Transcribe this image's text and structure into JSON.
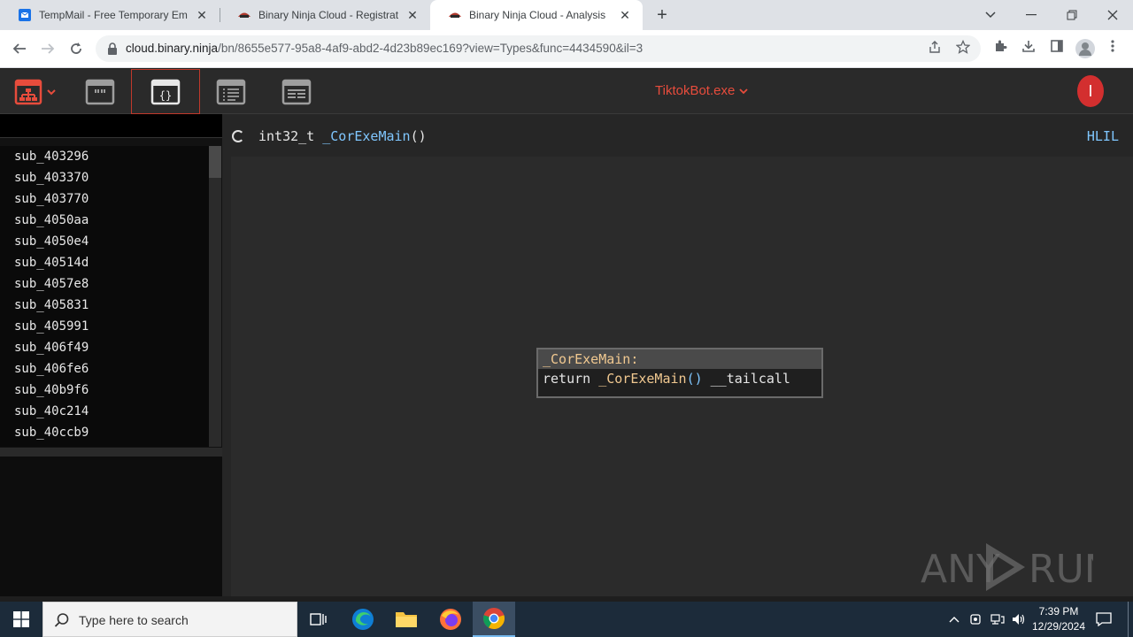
{
  "browser": {
    "tabs": [
      {
        "title": "TempMail - Free Temporary Ema",
        "active": false,
        "favicon": "tempmail-icon"
      },
      {
        "title": "Binary Ninja Cloud - Registration",
        "active": false,
        "favicon": "binja-icon"
      },
      {
        "title": "Binary Ninja Cloud - Analysis",
        "active": true,
        "favicon": "binja-icon"
      }
    ],
    "url_host": "cloud.binary.ninja",
    "url_path": "/bn/8655e577-95a8-4af9-abd2-4d23b89ec169?view=Types&func=4434590&il=3"
  },
  "app": {
    "file_title": "TiktokBot.exe",
    "user_initial": "I",
    "accent": "#e74c3c"
  },
  "sidebar": {
    "functions": [
      "sub_403296",
      "sub_403370",
      "sub_403770",
      "sub_4050aa",
      "sub_4050e4",
      "sub_40514d",
      "sub_4057e8",
      "sub_405831",
      "sub_405991",
      "sub_406f49",
      "sub_406fe6",
      "sub_40b9f6",
      "sub_40c214",
      "sub_40ccb9"
    ]
  },
  "main": {
    "return_type": "int32_t",
    "function_name": "_CorExeMain",
    "params": "()",
    "il_level": "HLIL",
    "block": {
      "label": "_CorExeMain:",
      "keyword": "return",
      "call": "_CorExeMain",
      "call_parens": "()",
      "suffix": "__tailcall"
    }
  },
  "taskbar": {
    "search_placeholder": "Type here to search",
    "time": "7:39 PM",
    "date": "12/29/2024"
  }
}
